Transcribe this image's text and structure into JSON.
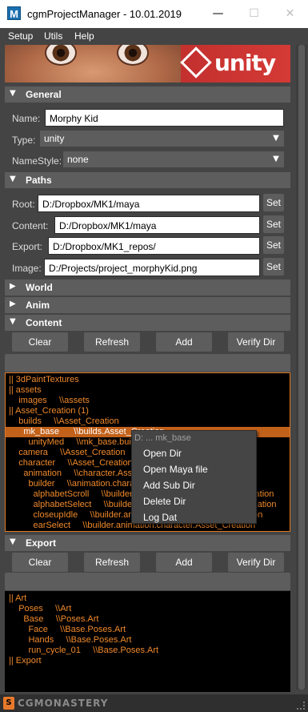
{
  "window": {
    "title": "cgmProjectManager - 10.01.2019",
    "app_icon_letter": "M",
    "minimize": "—",
    "maximize": "☐",
    "close": "✕"
  },
  "menubar": [
    "Setup",
    "Utils",
    "Help"
  ],
  "banner": {
    "logo_text": "unity"
  },
  "sections": {
    "general": {
      "label": "General",
      "arrow": "▼"
    },
    "paths": {
      "label": "Paths",
      "arrow": "▼"
    },
    "world": {
      "label": "World",
      "arrow": "▶"
    },
    "anim": {
      "label": "Anim",
      "arrow": "▶"
    },
    "content": {
      "label": "Content",
      "arrow": "▼"
    },
    "export": {
      "label": "Export",
      "arrow": "▼"
    }
  },
  "general": {
    "name_label": "Name:",
    "name_value": "Morphy Kid",
    "type_label": "Type:",
    "type_value": "unity",
    "namestyle_label": "NameStyle:",
    "namestyle_value": "none",
    "dropdown_arrow": "▼"
  },
  "paths": {
    "set_label": "Set",
    "root_label": "Root:",
    "root_value": "D:/Dropbox/MK1/maya",
    "content_label": "Content:",
    "content_value": "D:/Dropbox/MK1/maya",
    "export_label": "Export:",
    "export_value": "D:/Dropbox/MK1_repos/",
    "image_label": "Image:",
    "image_value": "D:/Projects/project_morphyKid.png"
  },
  "content_buttons": {
    "clear": "Clear",
    "refresh": "Refresh",
    "add": "Add",
    "verify": "Verify Dir"
  },
  "content_tree": [
    {
      "text": "|| 3dPaintTextures",
      "selected": false
    },
    {
      "text": "|| assets",
      "selected": false
    },
    {
      "text": "    images     \\\\assets",
      "selected": false
    },
    {
      "text": "|| Asset_Creation (1)",
      "selected": false
    },
    {
      "text": "    builds     \\\\Asset_Creation",
      "selected": false
    },
    {
      "text": "      mk_base      \\\\builds.Asset_Creation",
      "selected": true
    },
    {
      "text": "        unityMed     \\\\mk_base.builds.Asset_Creation",
      "selected": false
    },
    {
      "text": "    camera     \\\\Asset_Creation",
      "selected": false
    },
    {
      "text": "    character     \\\\Asset_Creation",
      "selected": false
    },
    {
      "text": "      animation     \\\\character.Asset_Creation",
      "selected": false
    },
    {
      "text": "        builder     \\\\animation.character.Asset_Creation",
      "selected": false
    },
    {
      "text": "          alphabetScroll     \\\\builder.animation.character.Asset_Creation",
      "selected": false
    },
    {
      "text": "          alphabetSelect     \\\\builder.animation.character.Asset_Creation",
      "selected": false
    },
    {
      "text": "          closeupIdle     \\\\builder.animation.character.Asset_Creation",
      "selected": false
    },
    {
      "text": "          earSelect     \\\\builder.animation.character.Asset_Creation",
      "selected": false
    }
  ],
  "context_menu": {
    "title": "D: ... mk_base",
    "items": [
      "Open Dir",
      "Open Maya file",
      "Add Sub Dir",
      "Delete Dir",
      "Log Dat"
    ]
  },
  "export_buttons": {
    "clear": "Clear",
    "refresh": "Refresh",
    "add": "Add",
    "verify": "Verify Dir"
  },
  "export_tree": [
    {
      "text": "|| Art"
    },
    {
      "text": "    Poses     \\\\Art"
    },
    {
      "text": "      Base     \\\\Poses.Art"
    },
    {
      "text": "        Face     \\\\Base.Poses.Art"
    },
    {
      "text": "        Hands     \\\\Base.Poses.Art"
    },
    {
      "text": "        run_cycle_01     \\\\Base.Poses.Art"
    },
    {
      "text": "|| Export"
    }
  ],
  "footer": {
    "logo_letter": "S",
    "text": "CGMONASTERY"
  },
  "colors": {
    "accent_orange": "#f0892b",
    "selected_row": "#c2611a",
    "panel_bg": "#444444",
    "header_bg": "#5d5d5d"
  }
}
